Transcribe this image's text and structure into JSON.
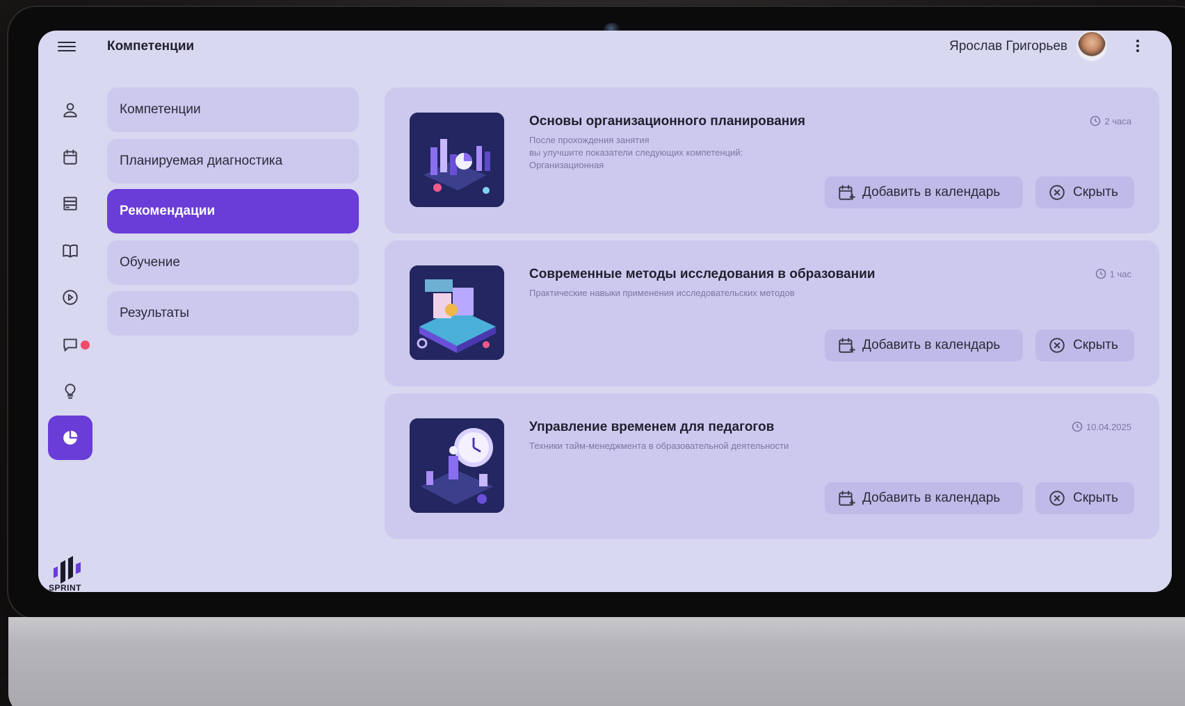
{
  "header": {
    "title": "Компетенции",
    "user_name": "Ярослав Григорьев"
  },
  "rail": {
    "items": [
      {
        "name": "profile",
        "icon": "user-icon"
      },
      {
        "name": "calendar",
        "icon": "calendar-icon"
      },
      {
        "name": "reports",
        "icon": "stack-icon"
      },
      {
        "name": "library",
        "icon": "book-icon"
      },
      {
        "name": "video",
        "icon": "play-icon"
      },
      {
        "name": "chat",
        "icon": "chat-icon",
        "has_notification": true
      },
      {
        "name": "ideas",
        "icon": "lightbulb-icon"
      },
      {
        "name": "competencies",
        "icon": "pie-chart-icon",
        "active": true
      }
    ],
    "logo_text": "SPRINT"
  },
  "subnav": {
    "items": [
      {
        "label": "Компетенции"
      },
      {
        "label": "Планируемая диагностика"
      },
      {
        "label": "Рекомендации",
        "active": true
      },
      {
        "label": "Обучение"
      },
      {
        "label": "Результаты"
      }
    ]
  },
  "recommendations": [
    {
      "title": "Основы организационного планирования",
      "description_lines": [
        "После прохождения занятия",
        "вы улучшите показатели следующих компетенций:",
        "Организационная"
      ],
      "meta": "2 часа",
      "add_label": "Добавить в календарь",
      "hide_label": "Скрыть"
    },
    {
      "title": "Современные методы исследования в образовании",
      "description_lines": [
        "Практические навыки применения исследовательских методов"
      ],
      "meta": "1 час",
      "add_label": "Добавить в календарь",
      "hide_label": "Скрыть"
    },
    {
      "title": "Управление временем для педагогов",
      "description_lines": [
        "Техники тайм-менеджмента в образовательной деятельности"
      ],
      "meta": "10.04.2025",
      "add_label": "Добавить в календарь",
      "hide_label": "Скрыть"
    }
  ],
  "colors": {
    "accent": "#6a3cd8",
    "screen_bg": "#d8d8f0",
    "card_bg": "#cdc9ee",
    "notification": "#f04b6a"
  }
}
